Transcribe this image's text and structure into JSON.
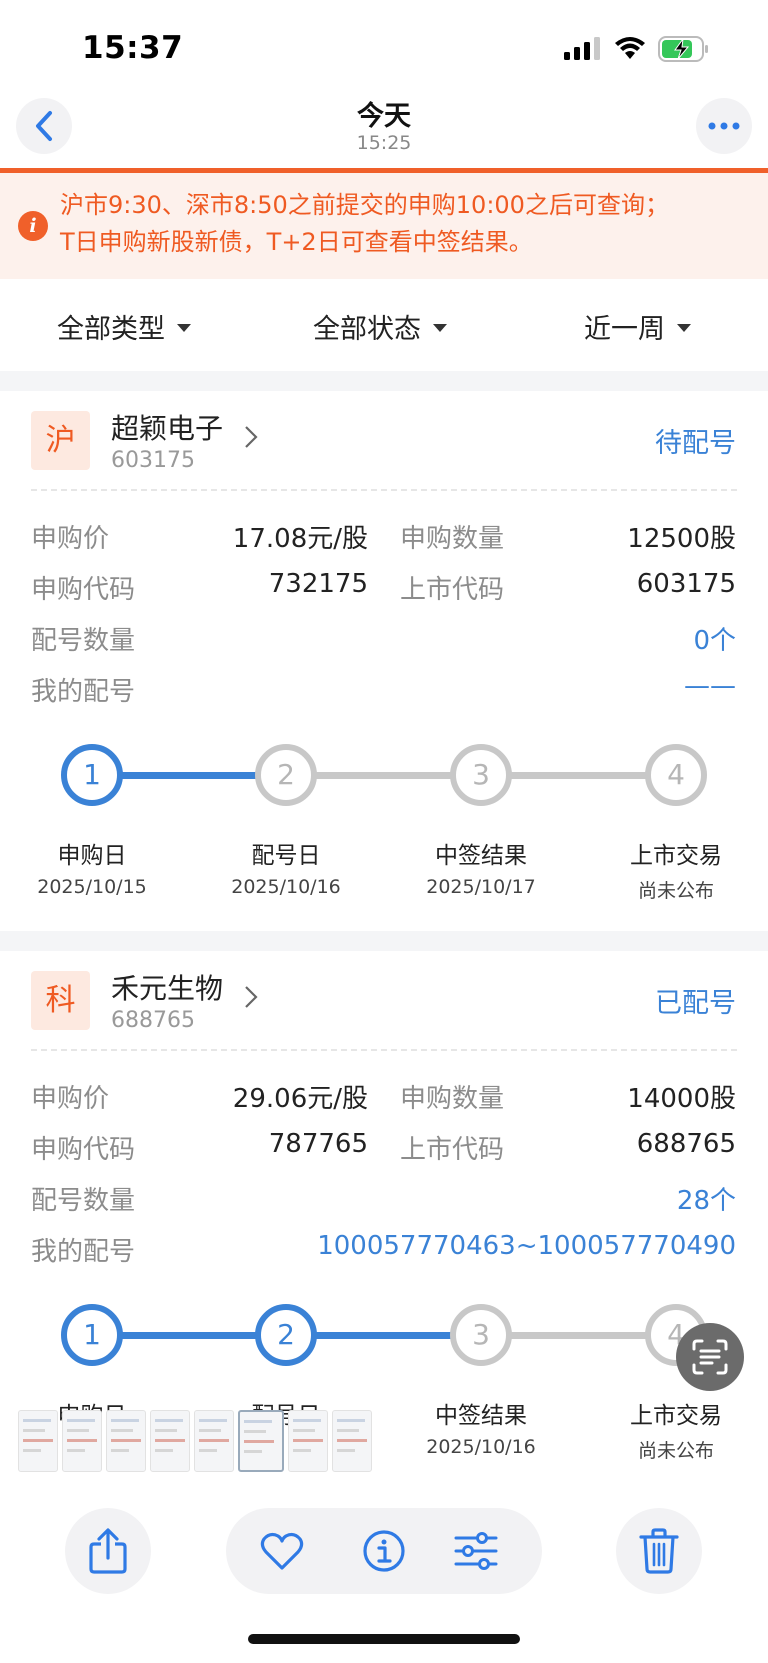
{
  "status_bar": {
    "time": "15:37"
  },
  "viewer": {
    "title": "今天",
    "subtitle": "15:25"
  },
  "notice": {
    "line1": "沪市9:30、深市8:50之前提交的申购10:00之后可查询；",
    "line2": "T日申购新股新债，T+2日可查看中签结果。"
  },
  "filters": {
    "type": "全部类型",
    "status": "全部状态",
    "period": "近一周"
  },
  "labels": {
    "price": "申购价",
    "qty": "申购数量",
    "sub_code": "申购代码",
    "list_code": "上市代码",
    "alloc_count": "配号数量",
    "my_alloc": "我的配号"
  },
  "cards": [
    {
      "market": "沪",
      "name": "超颖电子",
      "code": "603175",
      "status": "待配号",
      "price": "17.08元/股",
      "qty": "12500股",
      "sub_code": "732175",
      "list_code": "603175",
      "alloc_count": "0个",
      "my_alloc": "——",
      "progress": 1,
      "steps": [
        {
          "num": "1",
          "name": "申购日",
          "date": "2025/10/15"
        },
        {
          "num": "2",
          "name": "配号日",
          "date": "2025/10/16"
        },
        {
          "num": "3",
          "name": "中签结果",
          "date": "2025/10/17"
        },
        {
          "num": "4",
          "name": "上市交易",
          "date": "尚未公布"
        }
      ]
    },
    {
      "market": "科",
      "name": "禾元生物",
      "code": "688765",
      "status": "已配号",
      "price": "29.06元/股",
      "qty": "14000股",
      "sub_code": "787765",
      "list_code": "688765",
      "alloc_count": "28个",
      "my_alloc": "100057770463~100057770490",
      "progress": 2,
      "steps": [
        {
          "num": "1",
          "name": "申购日",
          "date": ""
        },
        {
          "num": "2",
          "name": "配号日",
          "date": ""
        },
        {
          "num": "3",
          "name": "中签结果",
          "date": "2025/10/16"
        },
        {
          "num": "4",
          "name": "上市交易",
          "date": "尚未公布"
        }
      ]
    }
  ],
  "colors": {
    "accent": "#3a82d6",
    "warning": "#ef5a22",
    "inactive": "#c8c8c8"
  }
}
